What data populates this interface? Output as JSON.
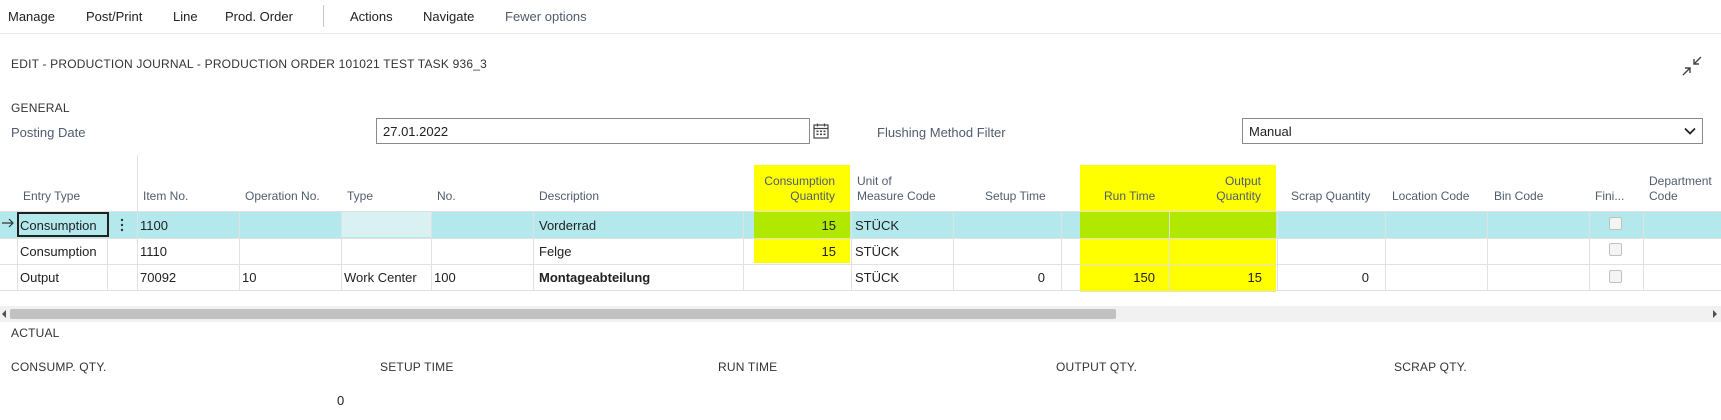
{
  "actionbar": {
    "items": [
      "Manage",
      "Post/Print",
      "Line",
      "Prod. Order",
      "Actions",
      "Navigate"
    ],
    "fewer_options": "Fewer options"
  },
  "page_title": "EDIT - PRODUCTION JOURNAL - PRODUCTION ORDER 101021 TEST TASK 936_3",
  "general": {
    "caption": "GENERAL",
    "posting_date_label": "Posting Date",
    "posting_date_value": "27.01.2022",
    "flushing_label": "Flushing Method Filter",
    "flushing_value": "Manual",
    "flushing_options": [
      "Manual"
    ]
  },
  "grid": {
    "headers": {
      "entry_type": "Entry Type",
      "item_no": "Item No.",
      "operation_no": "Operation No.",
      "type": "Type",
      "no": "No.",
      "description": "Description",
      "consumption_quantity_1": "Consumption",
      "consumption_quantity_2": "Quantity",
      "unit_of_measure_1": "Unit of",
      "unit_of_measure_2": "Measure Code",
      "setup_time": "Setup Time",
      "run_time": "Run Time",
      "output_quantity_1": "Output",
      "output_quantity_2": "Quantity",
      "scrap_quantity": "Scrap Quantity",
      "location_code": "Location Code",
      "bin_code": "Bin Code",
      "finished": "Fini...",
      "department_1": "Department",
      "department_2": "Code"
    },
    "rows": [
      {
        "entry_type": "Consumption",
        "item_no": "1100",
        "operation_no": "",
        "type": "",
        "no": "",
        "description": "Vorderrad",
        "consumption_quantity": "15",
        "unit": "STÜCK",
        "setup_time": "",
        "run_time": "",
        "output_quantity": "",
        "scrap_quantity": "",
        "location_code": "",
        "bin_code": "",
        "department_code": ""
      },
      {
        "entry_type": "Consumption",
        "item_no": "1110",
        "operation_no": "",
        "type": "",
        "no": "",
        "description": "Felge",
        "consumption_quantity": "15",
        "unit": "STÜCK",
        "setup_time": "",
        "run_time": "",
        "output_quantity": "",
        "scrap_quantity": "",
        "location_code": "",
        "bin_code": "",
        "department_code": ""
      },
      {
        "entry_type": "Output",
        "item_no": "70092",
        "operation_no": "10",
        "type": "Work Center",
        "no": "100",
        "description": "Montageabteilung",
        "consumption_quantity": "",
        "unit": "STÜCK",
        "setup_time": "0",
        "run_time": "150",
        "output_quantity": "15",
        "scrap_quantity": "0",
        "location_code": "",
        "bin_code": "",
        "department_code": ""
      }
    ]
  },
  "actual": {
    "caption": "ACTUAL",
    "consump_qty_label": "CONSUMP. QTY.",
    "consump_qty_value": "0",
    "setup_time_label": "SETUP TIME",
    "run_time_label": "RUN TIME",
    "output_qty_label": "OUTPUT QTY.",
    "scrap_qty_label": "SCRAP QTY."
  },
  "colors": {
    "highlight": "#ffff00",
    "selected_row": "#b3e9ec",
    "selected_highlight": "#b0e800"
  },
  "icons": [
    "calendar-icon",
    "chevron-down-icon",
    "collapse-icon",
    "row-arrow-icon",
    "row-menu-icon",
    "scroll-left-icon",
    "scroll-right-icon"
  ]
}
